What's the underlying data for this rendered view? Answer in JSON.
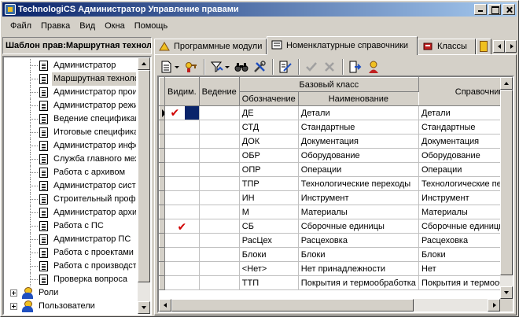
{
  "window": {
    "title": "TechnologiCS Администратор Управление правами"
  },
  "menu": [
    "Файл",
    "Правка",
    "Вид",
    "Окна",
    "Помощь"
  ],
  "left_panel": {
    "title": "Шаблон прав:Маршрутная технология",
    "tree_items": [
      {
        "label": "Администратор",
        "selected": false
      },
      {
        "label": "Маршрутная технология",
        "selected": true
      },
      {
        "label": "Администратор производства",
        "selected": false
      },
      {
        "label": "Администратор режима",
        "selected": false
      },
      {
        "label": "Ведение спецификаций",
        "selected": false
      },
      {
        "label": "Итоговые спецификации",
        "selected": false
      },
      {
        "label": "Администратор информации",
        "selected": false
      },
      {
        "label": "Служба главного механика",
        "selected": false
      },
      {
        "label": "Работа с архивом",
        "selected": false
      },
      {
        "label": "Администратор системы",
        "selected": false
      },
      {
        "label": "Строительный профиль",
        "selected": false
      },
      {
        "label": "Администратор архива",
        "selected": false
      },
      {
        "label": "Работа с ПС",
        "selected": false
      },
      {
        "label": "Администратор ПС",
        "selected": false
      },
      {
        "label": "Работа с проектами",
        "selected": false
      },
      {
        "label": "Работа с производством",
        "selected": false
      },
      {
        "label": "Проверка вопроса",
        "selected": false
      }
    ],
    "root_items": [
      {
        "label": "Роли",
        "icon": "roles-icon"
      },
      {
        "label": "Пользователи",
        "icon": "users-icon"
      }
    ]
  },
  "tabs": [
    {
      "label": "Программные модули",
      "icon": "modules-icon",
      "active": false
    },
    {
      "label": "Номенклатурные справочники",
      "icon": "catalog-icon",
      "active": true
    },
    {
      "label": "Классы",
      "icon": "classes-icon",
      "active": false
    }
  ],
  "grid": {
    "headers": {
      "visible": "Видим.",
      "maintain": "Ведение",
      "base_class": "Базовый класс",
      "designation": "Обозначение",
      "name": "Наименование",
      "reference": "Справочник"
    },
    "rows": [
      {
        "visible": true,
        "maintain": "",
        "designation": "ДЕ",
        "name": "Детали",
        "reference": "Детали",
        "current": true
      },
      {
        "visible": false,
        "maintain": "",
        "designation": "СТД",
        "name": "Стандартные",
        "reference": "Стандартные"
      },
      {
        "visible": false,
        "maintain": "",
        "designation": "ДОК",
        "name": "Документация",
        "reference": "Документация"
      },
      {
        "visible": false,
        "maintain": "",
        "designation": "ОБР",
        "name": "Оборудование",
        "reference": "Оборудование"
      },
      {
        "visible": false,
        "maintain": "",
        "designation": "ОПР",
        "name": "Операции",
        "reference": "Операции"
      },
      {
        "visible": false,
        "maintain": "",
        "designation": "ТПР",
        "name": "Технологические переходы",
        "reference": "Технологические переходы"
      },
      {
        "visible": false,
        "maintain": "",
        "designation": "ИН",
        "name": "Инструмент",
        "reference": "Инструмент"
      },
      {
        "visible": false,
        "maintain": "",
        "designation": "М",
        "name": "Материалы",
        "reference": "Материалы"
      },
      {
        "visible": true,
        "maintain": "",
        "designation": "СБ",
        "name": "Сборочные единицы",
        "reference": "Сборочные единицы"
      },
      {
        "visible": false,
        "maintain": "",
        "designation": "РасЦех",
        "name": "Расцеховка",
        "reference": "Расцеховка"
      },
      {
        "visible": false,
        "maintain": "",
        "designation": "Блоки",
        "name": "Блоки",
        "reference": "Блоки"
      },
      {
        "visible": false,
        "maintain": "",
        "designation": "<Нет>",
        "name": "Нет принадлежности",
        "reference": "Нет"
      },
      {
        "visible": false,
        "maintain": "",
        "designation": "ТТП",
        "name": "Покрытия и термообработка",
        "reference": "Покрытия и термообработка"
      }
    ]
  },
  "check_glyph": "✔",
  "colors": {
    "title_start": "#0a246a",
    "title_end": "#a6caf0",
    "check": "#d00000",
    "selection": "#0a246a"
  }
}
